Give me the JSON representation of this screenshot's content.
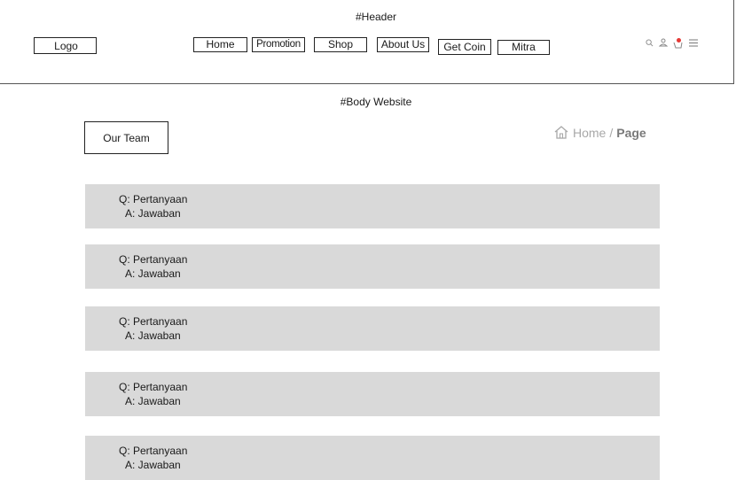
{
  "header": {
    "label": "#Header",
    "logo": "Logo",
    "nav": [
      {
        "label": "Home"
      },
      {
        "label": "Promotion"
      },
      {
        "label": "Shop"
      },
      {
        "label": "About Us"
      },
      {
        "label": "Get Coin"
      },
      {
        "label": "Mitra"
      }
    ],
    "icons": [
      "search-icon",
      "user-icon",
      "cart-icon",
      "menu-icon"
    ]
  },
  "body": {
    "label": "#Body Website",
    "section_title": "Our Team",
    "breadcrumb": {
      "home": "Home",
      "separator": "/",
      "current": "Page"
    },
    "faq": [
      {
        "q": "Q: Pertanyaan",
        "a": "A: Jawaban"
      },
      {
        "q": "Q: Pertanyaan",
        "a": "A: Jawaban"
      },
      {
        "q": "Q: Pertanyaan",
        "a": "A: Jawaban"
      },
      {
        "q": "Q: Pertanyaan",
        "a": "A: Jawaban"
      },
      {
        "q": "Q: Pertanyaan",
        "a": "A: Jawaban"
      }
    ]
  },
  "colors": {
    "faq_background": "#d9d9d9",
    "badge": "#e53935",
    "breadcrumb": "#a8a8a8"
  }
}
